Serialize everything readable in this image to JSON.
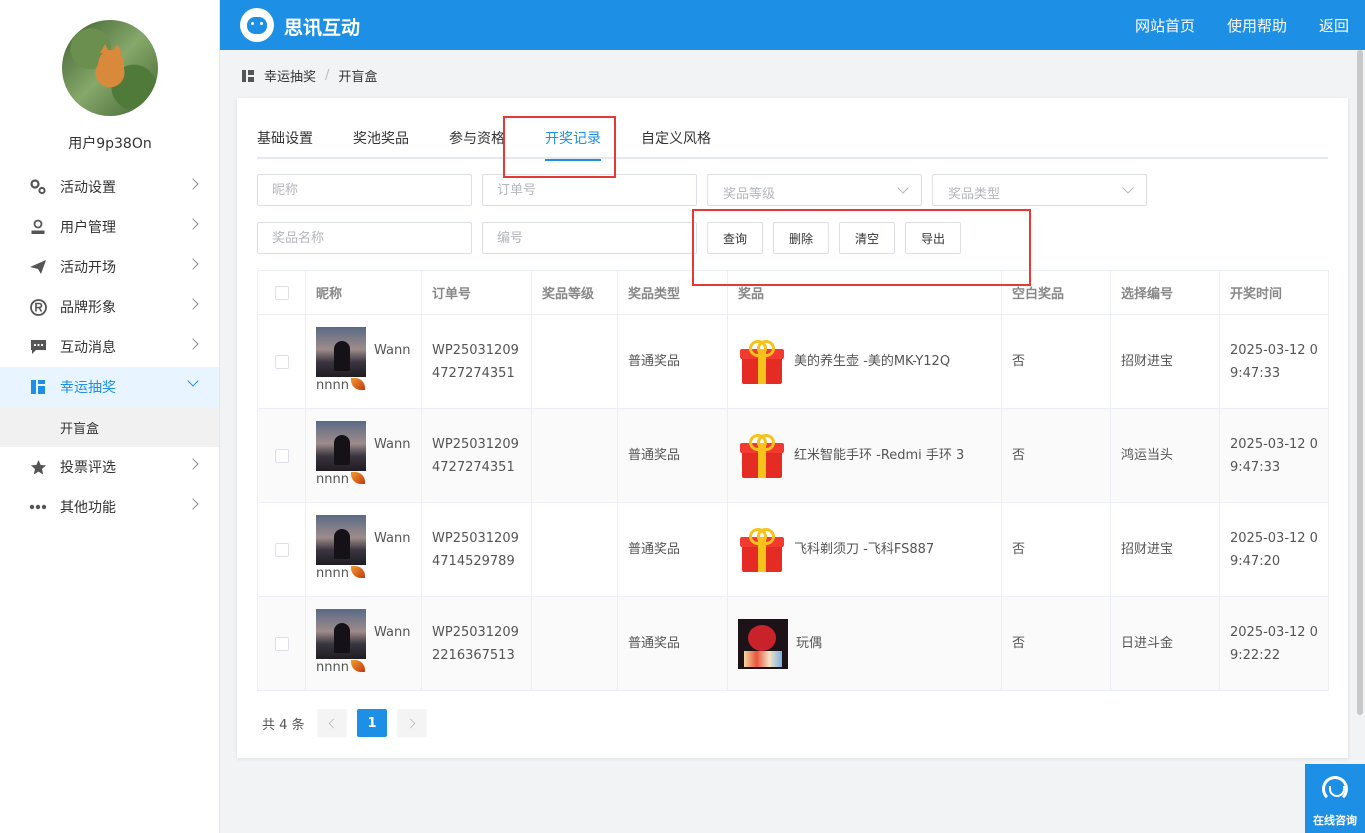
{
  "sidebar": {
    "username": "用户9p38On",
    "menu": [
      {
        "label": "活动设置",
        "icon": "gears-icon"
      },
      {
        "label": "用户管理",
        "icon": "user-icon"
      },
      {
        "label": "活动开场",
        "icon": "paper-plane-icon"
      },
      {
        "label": "品牌形象",
        "icon": "registered-icon"
      },
      {
        "label": "互动消息",
        "icon": "chat-icon"
      },
      {
        "label": "幸运抽奖",
        "icon": "dashboard-icon"
      },
      {
        "label": "投票评选",
        "icon": "star-icon"
      },
      {
        "label": "其他功能",
        "icon": "more-icon"
      }
    ],
    "submenu_label": "开盲盒"
  },
  "header": {
    "brand": "思讯互动",
    "nav": [
      "网站首页",
      "使用帮助",
      "返回"
    ],
    "color": "#1d8fe5"
  },
  "breadcrumb": {
    "parent": "幸运抽奖",
    "separator": "/",
    "current": "开盲盒"
  },
  "tabs": [
    "基础设置",
    "奖池奖品",
    "参与资格",
    "开奖记录",
    "自定义风格"
  ],
  "active_tab": "开奖记录",
  "filters": {
    "nickname_placeholder": "昵称",
    "order_placeholder": "订单号",
    "level_placeholder": "奖品等级",
    "type_placeholder": "奖品类型",
    "name_placeholder": "奖品名称",
    "code_placeholder": "编号"
  },
  "buttons": {
    "query": "查询",
    "delete": "删除",
    "clear": "清空",
    "export": "导出"
  },
  "table": {
    "headers": [
      "昵称",
      "订单号",
      "奖品等级",
      "奖品类型",
      "奖品",
      "空白奖品",
      "选择编号",
      "开奖时间"
    ],
    "rows": [
      {
        "nick1": "Wann",
        "nick2": "nnnn",
        "order1": "WP25031209",
        "order2": "4727274351",
        "level": "",
        "type": "普通奖品",
        "prize": "美的养生壶 -美的MK-Y12Q",
        "prize_icon": "gift-icon",
        "blank": "否",
        "code": "招财进宝",
        "time1": "2025-03-12 0",
        "time2": "9:47:33"
      },
      {
        "nick1": "Wann",
        "nick2": "nnnn",
        "order1": "WP25031209",
        "order2": "4727274351",
        "level": "",
        "type": "普通奖品",
        "prize": "红米智能手环 -Redmi 手环 3",
        "prize_icon": "gift-icon",
        "blank": "否",
        "code": "鸿运当头",
        "time1": "2025-03-12 0",
        "time2": "9:47:33"
      },
      {
        "nick1": "Wann",
        "nick2": "nnnn",
        "order1": "WP25031209",
        "order2": "4714529789",
        "level": "",
        "type": "普通奖品",
        "prize": "飞科剃须刀 -飞科FS887",
        "prize_icon": "gift-icon",
        "blank": "否",
        "code": "招财进宝",
        "time1": "2025-03-12 0",
        "time2": "9:47:20"
      },
      {
        "nick1": "Wann",
        "nick2": "nnnn",
        "order1": "WP25031209",
        "order2": "2216367513",
        "level": "",
        "type": "普通奖品",
        "prize": "玩偶",
        "prize_icon": "doll-image",
        "blank": "否",
        "code": "日进斗金",
        "time1": "2025-03-12 0",
        "time2": "9:22:22"
      }
    ]
  },
  "pagination": {
    "total": "共 4 条",
    "current_page": "1"
  },
  "consult": {
    "label": "在线咨询"
  }
}
